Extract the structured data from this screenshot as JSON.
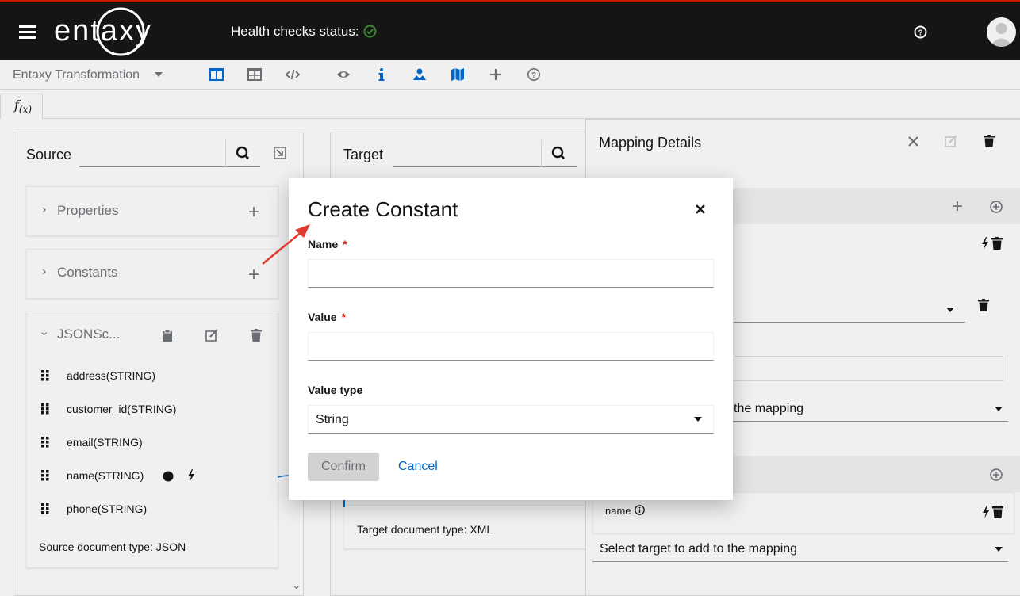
{
  "header": {
    "logo_text": "entaxy",
    "health_label": "Health checks status:",
    "health_color": "#3e8635"
  },
  "toolbar": {
    "title": "Entaxy Transformation",
    "icons": [
      "columns-view-icon",
      "table-view-icon",
      "code-view-icon",
      "eye-icon",
      "info-icon",
      "map-marked-icon",
      "map-icon",
      "plus-icon",
      "help-icon"
    ],
    "accent_color": "#0066cc"
  },
  "tabs": {
    "fx": "f",
    "fx_sub": "(x)"
  },
  "source": {
    "title": "Source",
    "properties_label": "Properties",
    "constants_label": "Constants",
    "schema_label": "JSONSc...",
    "fields": [
      "address(STRING)",
      "customer_id(STRING)",
      "email(STRING)",
      "name(STRING)",
      "phone(STRING)"
    ],
    "doc_type": "Source document type: JSON"
  },
  "target": {
    "title": "Target",
    "doc_type": "Target document type: XML"
  },
  "mapping_details": {
    "title": "Mapping Details",
    "select_partial": "the mapping",
    "field_name": "name",
    "select_target": "Select target to add to the mapping"
  },
  "modal": {
    "title": "Create Constant",
    "name_label": "Name",
    "value_label": "Value",
    "required_mark": "*",
    "value_type_label": "Value type",
    "value_type_selected": "String",
    "confirm_label": "Confirm",
    "cancel_label": "Cancel",
    "name_value": "",
    "value_value": ""
  }
}
